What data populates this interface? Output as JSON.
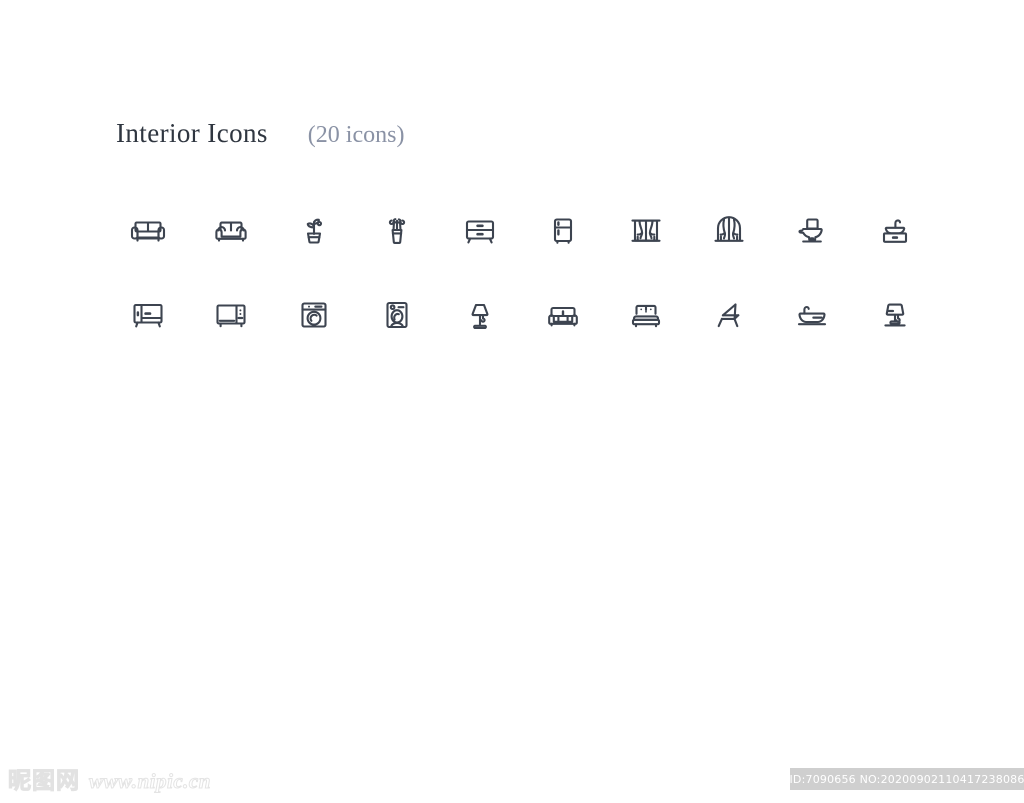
{
  "header": {
    "title": "Interior Icons",
    "count_label": "(20 icons)"
  },
  "colors": {
    "background": "#ffffff",
    "icon_stroke": "#3d4450",
    "title": "#2f3640",
    "subtitle": "#8a92a5",
    "watermark_bar": "#cfcfcf",
    "watermark_text": "#ffffff"
  },
  "grid": {
    "columns": 10,
    "rows": 2,
    "icons": [
      {
        "name": "sofa-square-arms-icon",
        "label": "Sofa"
      },
      {
        "name": "sofa-rounded-arms-icon",
        "label": "Loveseat"
      },
      {
        "name": "potted-plant-icon",
        "label": "Potted plant"
      },
      {
        "name": "flower-vase-icon",
        "label": "Flower vase"
      },
      {
        "name": "dresser-icon",
        "label": "Dresser"
      },
      {
        "name": "refrigerator-icon",
        "label": "Refrigerator"
      },
      {
        "name": "window-curtains-icon",
        "label": "Curtained window"
      },
      {
        "name": "arched-window-icon",
        "label": "Arched window"
      },
      {
        "name": "toilet-icon",
        "label": "Toilet"
      },
      {
        "name": "sink-vanity-icon",
        "label": "Sink vanity"
      },
      {
        "name": "tv-cabinet-icon",
        "label": "TV cabinet"
      },
      {
        "name": "microwave-icon",
        "label": "Microwave"
      },
      {
        "name": "washing-machine-icon",
        "label": "Washing machine"
      },
      {
        "name": "dryer-icon",
        "label": "Clothes dryer"
      },
      {
        "name": "floor-lamp-icon",
        "label": "Floor lamp"
      },
      {
        "name": "armchair-sofa-icon",
        "label": "Armchair sofa"
      },
      {
        "name": "double-bed-icon",
        "label": "Double bed"
      },
      {
        "name": "folding-chair-icon",
        "label": "Folding chair"
      },
      {
        "name": "bathtub-icon",
        "label": "Bathtub"
      },
      {
        "name": "table-lamp-icon",
        "label": "Table lamp"
      }
    ]
  },
  "watermark": {
    "site_cn": "昵图网",
    "site_url": "www.nipic.cn",
    "id_text": "ID:7090656 NO:20200902110417238086"
  }
}
